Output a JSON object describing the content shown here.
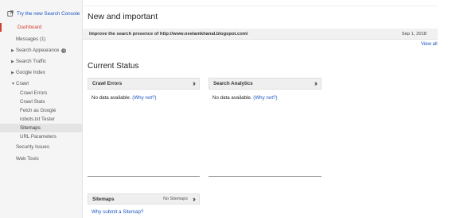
{
  "sidebar": {
    "try_link": "Try the new Search Console",
    "items": [
      {
        "label": "Dashboard"
      },
      {
        "label": "Messages (1)"
      },
      {
        "label": "Search Appearance"
      },
      {
        "label": "Search Traffic"
      },
      {
        "label": "Google Index"
      },
      {
        "label": "Crawl"
      },
      {
        "label": "Crawl Errors"
      },
      {
        "label": "Crawl Stats"
      },
      {
        "label": "Fetch as Google"
      },
      {
        "label": "robots.txt Tester"
      },
      {
        "label": "Sitemaps"
      },
      {
        "label": "URL Parameters"
      },
      {
        "label": "Security Issues"
      },
      {
        "label": "Web Tools"
      }
    ]
  },
  "main": {
    "new_important_title": "New and important",
    "message": {
      "text": "Improve the search presence of http://www.neelamkhanal.blogspot.com/",
      "date": "Sep 1, 2018"
    },
    "view_all": "View all",
    "current_status_title": "Current Status",
    "crawl_errors": {
      "title": "Crawl Errors",
      "body": "No data available.",
      "why": "(Why not?)"
    },
    "search_analytics": {
      "title": "Search Analytics",
      "body": "No data available.",
      "why": "(Why not?)"
    },
    "sitemaps": {
      "title": "Sitemaps",
      "count": "No Sitemaps",
      "why_submit": "Why submit a Sitemap?"
    }
  },
  "colors": {
    "accent_red": "#d23f31",
    "link_blue": "#1a55c0"
  }
}
